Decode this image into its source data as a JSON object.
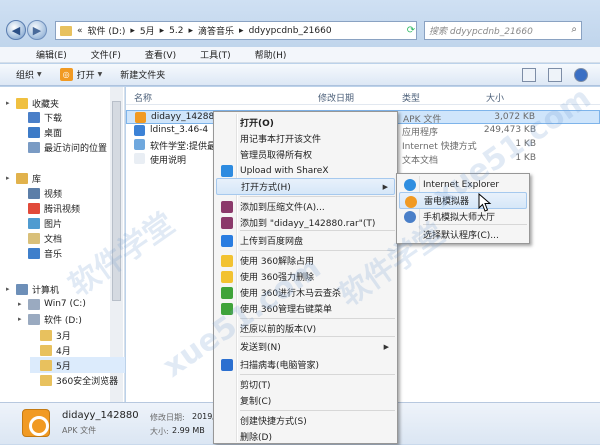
{
  "address": {
    "overflow": "«",
    "segments": [
      "软件 (D:)",
      "5月",
      "5.2",
      "滴答音乐",
      "ddyypcdnb_21660"
    ],
    "search_placeholder": "搜索 ddyypcdnb_21660"
  },
  "menubar": [
    "编辑(E)",
    "文件(F)",
    "查看(V)",
    "工具(T)",
    "帮助(H)"
  ],
  "toolbar": {
    "organize": "组织",
    "open": "打开",
    "new_folder": "新建文件夹"
  },
  "nav": [
    {
      "label": "收藏夹",
      "icon": "star-icon",
      "color": "#f0c040",
      "indent": 0
    },
    {
      "label": "下载",
      "icon": "download-folder-icon",
      "color": "#4a7fc8",
      "indent": 1
    },
    {
      "label": "桌面",
      "icon": "desktop-icon",
      "color": "#3d7bc7",
      "indent": 1
    },
    {
      "label": "最近访问的位置",
      "icon": "recent-icon",
      "color": "#7a9bc4",
      "indent": 1
    },
    {
      "label": "库",
      "icon": "library-icon",
      "color": "#e1b24c",
      "indent": 0
    },
    {
      "label": "视频",
      "icon": "video-icon",
      "color": "#5c7ea8",
      "indent": 1
    },
    {
      "label": "腾讯视频",
      "icon": "video-icon",
      "color": "#e14a3a",
      "indent": 1
    },
    {
      "label": "图片",
      "icon": "picture-icon",
      "color": "#4f9bd0",
      "indent": 1
    },
    {
      "label": "文档",
      "icon": "document-icon",
      "color": "#d9c07a",
      "indent": 1
    },
    {
      "label": "音乐",
      "icon": "music-icon",
      "color": "#3f7fcb",
      "indent": 1
    },
    {
      "label": "计算机",
      "icon": "computer-icon",
      "color": "#6d8fb8",
      "indent": 0
    },
    {
      "label": "Win7 (C:)",
      "icon": "drive-icon",
      "color": "#9aaac0",
      "indent": 1
    },
    {
      "label": "软件 (D:)",
      "icon": "drive-icon",
      "color": "#9aaac0",
      "indent": 1
    },
    {
      "label": "3月",
      "icon": "folder-icon",
      "color": "#e8c15e",
      "indent": 2
    },
    {
      "label": "4月",
      "icon": "folder-icon",
      "color": "#e8c15e",
      "indent": 2
    },
    {
      "label": "5月",
      "icon": "folder-icon",
      "color": "#e8c15e",
      "indent": 2
    },
    {
      "label": "360安全浏览器",
      "icon": "folder-icon",
      "color": "#e8c15e",
      "indent": 2
    }
  ],
  "columns": {
    "name": "名称",
    "date": "修改日期",
    "type": "类型",
    "size": "大小"
  },
  "files": [
    {
      "name": "didayy_142880",
      "type": "APK 文件",
      "size": "3,072 KB",
      "color": "#f19a23",
      "selected": true
    },
    {
      "name": "ldinst_3.46-4",
      "type": "应用程序",
      "size": "249,473 KB",
      "color": "#3c82d6",
      "selected": false
    },
    {
      "name": "软件学堂:提供最新",
      "type": "Internet 快捷方式",
      "size": "1 KB",
      "color": "#6fa8de",
      "selected": false
    },
    {
      "name": "使用说明",
      "type": "文本文档",
      "size": "1 KB",
      "color": "#e9eef4",
      "selected": false
    }
  ],
  "context_menu": [
    {
      "label": "打开(O)",
      "bold": true,
      "icon": "",
      "color": ""
    },
    {
      "label": "用记事本打开该文件",
      "icon": "",
      "color": ""
    },
    {
      "label": "管理员取得所有权",
      "icon": "",
      "color": ""
    },
    {
      "label": "Upload with ShareX",
      "icon": "sharex-icon",
      "color": "#2d8be0"
    },
    {
      "label": "打开方式(H)",
      "icon": "",
      "color": "",
      "submenu": true,
      "highlight": true
    },
    {
      "label": "添加到压缩文件(A)...",
      "icon": "winrar-icon",
      "color": "#8b3a6b"
    },
    {
      "label": "添加到 \"didayy_142880.rar\"(T)",
      "icon": "winrar-icon",
      "color": "#8b3a6b"
    },
    {
      "label": "上传到百度网盘",
      "icon": "baidu-pan-icon",
      "color": "#2a7de1"
    },
    {
      "label": "使用 360解除占用",
      "icon": "360-unlock-icon",
      "color": "#f2c230"
    },
    {
      "label": "使用 360强力删除",
      "icon": "360-delete-icon",
      "color": "#f2c230"
    },
    {
      "label": "使用 360进行木马云查杀",
      "icon": "360-scan-icon",
      "color": "#3fa33a"
    },
    {
      "label": "使用 360管理右键菜单",
      "icon": "360-menu-icon",
      "color": "#3fa33a"
    },
    {
      "label": "还原以前的版本(V)",
      "icon": "",
      "color": ""
    },
    {
      "label": "发送到(N)",
      "icon": "",
      "color": "",
      "submenu": true
    },
    {
      "label": "扫描病毒(电脑管家)",
      "icon": "shield-icon",
      "color": "#2b6fd0"
    },
    {
      "label": "剪切(T)",
      "icon": "",
      "color": ""
    },
    {
      "label": "复制(C)",
      "icon": "",
      "color": ""
    },
    {
      "label": "创建快捷方式(S)",
      "icon": "",
      "color": ""
    },
    {
      "label": "删除(D)",
      "icon": "",
      "color": ""
    }
  ],
  "open_with": [
    {
      "label": "Internet Explorer",
      "icon": "ie-icon",
      "color": "#2f8ee0"
    },
    {
      "label": "雷电模拟器",
      "icon": "ldplayer-icon",
      "color": "#f19a23",
      "highlight": true
    },
    {
      "label": "手机模拟大师大厅",
      "icon": "phone-sim-icon",
      "color": "#4a7fc8"
    },
    {
      "label": "选择默认程序(C)...",
      "icon": "",
      "color": ""
    }
  ],
  "status": {
    "name": "didayy_142880",
    "date_label": "修改日期:",
    "date": "2019/4/23",
    "type": "APK 文件",
    "size_label": "大小:",
    "size": "2.99 MB"
  },
  "watermarks": [
    "软件学堂",
    "xue51.com",
    "软件学堂",
    "xue51.com"
  ]
}
